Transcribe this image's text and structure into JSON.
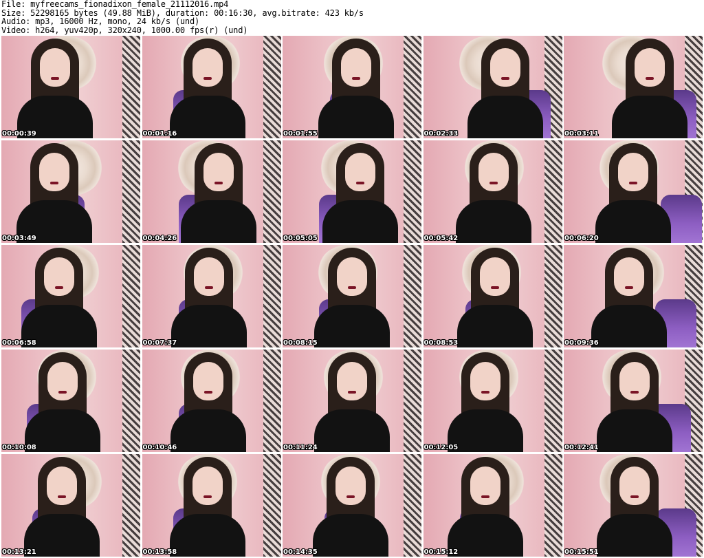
{
  "header": {
    "file_line": "File: myfreecams_fionadixon_female_21112016.mp4",
    "size_line": "Size: 52298165 bytes (49.88 MiB), duration: 00:16:30, avg.bitrate: 423 kb/s",
    "audio_line": "Audio: mp3, 16000 Hz, mono, 24 kb/s (und)",
    "video_line": "Video: h264, yuv420p, 320x240, 1000.00 fps(r) (und)"
  },
  "thumbnails": [
    {
      "timestamp": "00:00:39"
    },
    {
      "timestamp": "00:01:16"
    },
    {
      "timestamp": "00:01:55"
    },
    {
      "timestamp": "00:02:33"
    },
    {
      "timestamp": "00:03:11"
    },
    {
      "timestamp": "00:03:49"
    },
    {
      "timestamp": "00:04:26"
    },
    {
      "timestamp": "00:05:05"
    },
    {
      "timestamp": "00:05:42"
    },
    {
      "timestamp": "00:06:20"
    },
    {
      "timestamp": "00:06:58"
    },
    {
      "timestamp": "00:07:37"
    },
    {
      "timestamp": "00:08:15"
    },
    {
      "timestamp": "00:08:53"
    },
    {
      "timestamp": "00:09:36"
    },
    {
      "timestamp": "00:10:08"
    },
    {
      "timestamp": "00:10:46"
    },
    {
      "timestamp": "00:11:24"
    },
    {
      "timestamp": "00:12:05"
    },
    {
      "timestamp": "00:12:41"
    },
    {
      "timestamp": "00:13:21"
    },
    {
      "timestamp": "00:13:58"
    },
    {
      "timestamp": "00:14:35"
    },
    {
      "timestamp": "00:15:12"
    },
    {
      "timestamp": "00:15:51"
    }
  ]
}
